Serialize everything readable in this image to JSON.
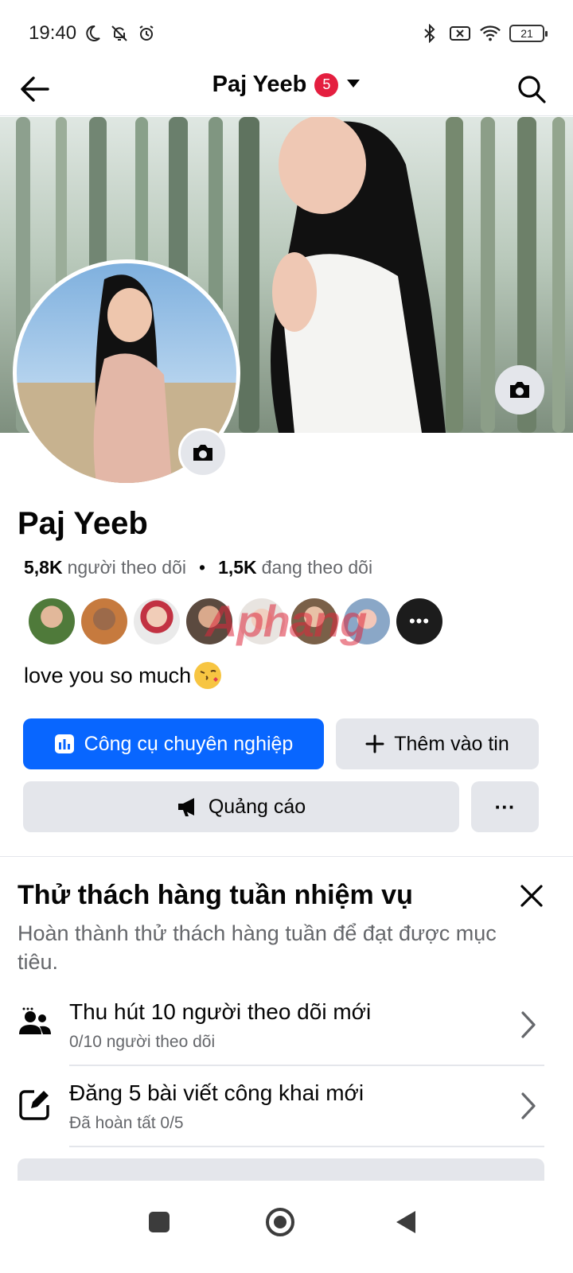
{
  "status_bar": {
    "time": "19:40",
    "battery": "21",
    "icons_left": [
      "moon-icon",
      "bell-off-icon",
      "alarm-icon"
    ],
    "icons_right": [
      "bluetooth-icon",
      "sim-off-icon",
      "wifi-icon",
      "battery-icon"
    ]
  },
  "header": {
    "title": "Paj Yeeb",
    "badge_count": "5"
  },
  "profile": {
    "name": "Paj Yeeb",
    "followers_count": "5,8K",
    "followers_label": "người theo dõi",
    "following_count": "1,5K",
    "following_label": "đang theo dõi",
    "watermark": "Aphang",
    "bio": "love you so much"
  },
  "actions": {
    "pro_tools": "Công cụ chuyên nghiệp",
    "add_story": "Thêm vào tin",
    "ads": "Quảng cáo",
    "more": "···"
  },
  "challenge": {
    "title": "Thử thách hàng tuần nhiệm vụ",
    "description": "Hoàn thành thử thách hàng tuần để đạt được mục tiêu.",
    "tasks": [
      {
        "title": "Thu hút 10 người theo dõi mới",
        "subtitle": "0/10 người theo dõi",
        "icon": "people-icon"
      },
      {
        "title": "Đăng 5 bài viết công khai mới",
        "subtitle": "Đã hoàn tất 0/5",
        "icon": "edit-icon"
      }
    ]
  },
  "colors": {
    "primary": "#0866ff",
    "secondary_button": "#e4e6eb",
    "badge": "#e41e3f",
    "muted_text": "#65676b"
  }
}
